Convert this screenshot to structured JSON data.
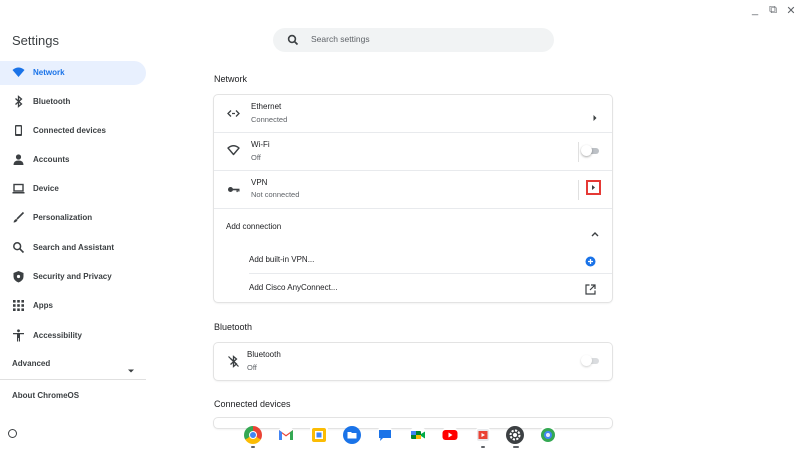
{
  "window": {
    "title": "Settings",
    "minimize": "_",
    "restore": "⧉",
    "close": "✕"
  },
  "search": {
    "placeholder": "Search settings"
  },
  "sidebar": {
    "items": [
      {
        "label": "Network",
        "icon": "wifi-icon",
        "active": true
      },
      {
        "label": "Bluetooth",
        "icon": "bluetooth-icon"
      },
      {
        "label": "Connected devices",
        "icon": "phone-icon"
      },
      {
        "label": "Accounts",
        "icon": "person-icon"
      },
      {
        "label": "Device",
        "icon": "laptop-icon"
      },
      {
        "label": "Personalization",
        "icon": "brush-icon"
      },
      {
        "label": "Search and Assistant",
        "icon": "search-icon"
      },
      {
        "label": "Security and Privacy",
        "icon": "shield-icon"
      },
      {
        "label": "Apps",
        "icon": "apps-grid-icon"
      },
      {
        "label": "Accessibility",
        "icon": "accessibility-icon"
      }
    ],
    "advanced": "Advanced",
    "about": "About ChromeOS"
  },
  "network": {
    "title": "Network",
    "rows": [
      {
        "title": "Ethernet",
        "status": "Connected",
        "icon": "ethernet-icon"
      },
      {
        "title": "Wi-Fi",
        "status": "Off",
        "icon": "wifi-outline-icon",
        "toggle": false
      },
      {
        "title": "VPN",
        "status": "Not connected",
        "icon": "key-icon"
      }
    ],
    "add_connection": "Add connection",
    "add_builtin_vpn": "Add built-in VPN...",
    "add_cisco": "Add Cisco AnyConnect..."
  },
  "bluetooth": {
    "title": "Bluetooth",
    "row": {
      "title": "Bluetooth",
      "status": "Off",
      "icon": "bluetooth-off-icon",
      "toggle": false
    }
  },
  "connected_devices": {
    "title": "Connected devices"
  },
  "shelf": {
    "apps": [
      "chrome",
      "gmail",
      "docs",
      "files",
      "messages",
      "meet",
      "youtube",
      "play-movies",
      "settings",
      "camera"
    ]
  },
  "colors": {
    "accent": "#1a73e8",
    "active_bg": "#e8f0fe",
    "highlight": "#e53935"
  }
}
